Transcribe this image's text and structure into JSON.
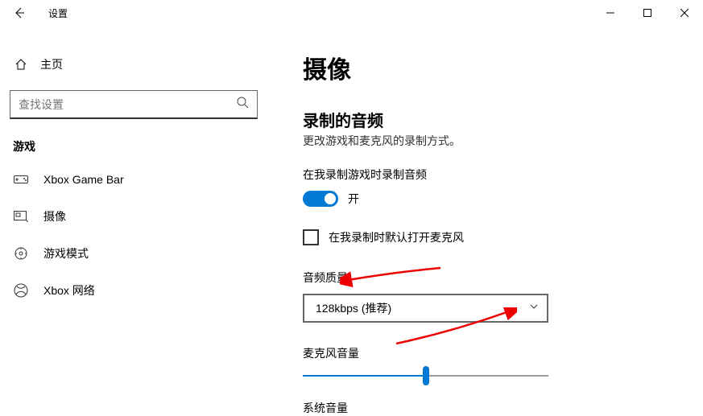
{
  "titlebar": {
    "title": "设置"
  },
  "sidebar": {
    "home_label": "主页",
    "search_placeholder": "查找设置",
    "category": "游戏",
    "items": [
      {
        "id": "xbox-game-bar",
        "label": "Xbox Game Bar"
      },
      {
        "id": "capture",
        "label": "摄像"
      },
      {
        "id": "game-mode",
        "label": "游戏模式"
      },
      {
        "id": "xbox-network",
        "label": "Xbox 网络"
      }
    ]
  },
  "content": {
    "page_title": "摄像",
    "section_title": "录制的音频",
    "section_desc": "更改游戏和麦克风的录制方式。",
    "record_audio_label": "在我录制游戏时录制音频",
    "toggle_state": "开",
    "mic_checkbox_label": "在我录制时默认打开麦克风",
    "audio_quality_label": "音频质量",
    "audio_quality_value": "128kbps (推荐)",
    "mic_volume_label": "麦克风音量",
    "mic_volume_pct": 50,
    "system_volume_label": "系统音量"
  }
}
